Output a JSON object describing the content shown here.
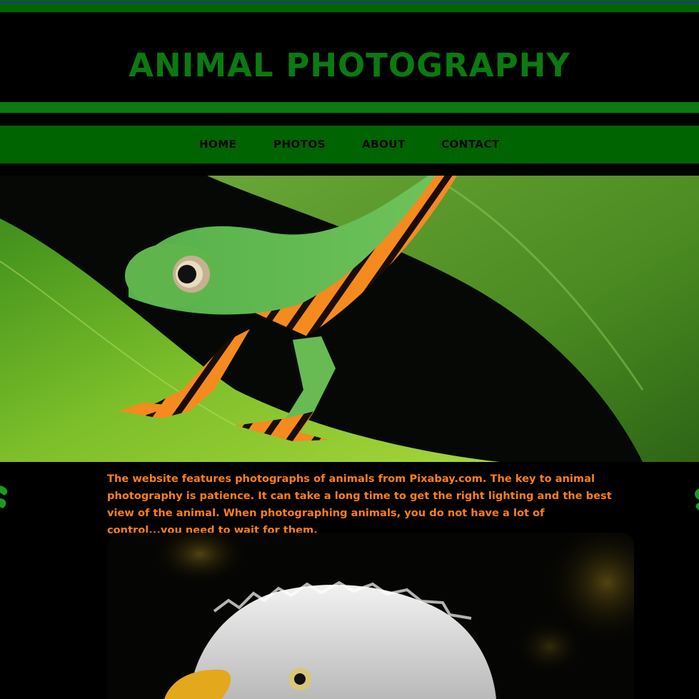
{
  "header": {
    "title": "ANIMAL PHOTOGRAPHY"
  },
  "nav": {
    "items": [
      "HOME",
      "PHOTOS",
      "ABOUT",
      "CONTACT"
    ]
  },
  "intro": {
    "text": "The website features photographs of animals from Pixabay.com. The key to animal photography is patience. It can take a long time to get the right lighting and the best view of the animal. When photographing animals, you do not have a lot of control...you need to wait for them."
  },
  "colors": {
    "brand_green": "#0b7a10",
    "nav_green": "#006400",
    "accent_orange": "#ff7f1a",
    "background": "#000000"
  },
  "images": {
    "hero": "tree-frog-photo",
    "second": "bald-eagle-photo"
  }
}
